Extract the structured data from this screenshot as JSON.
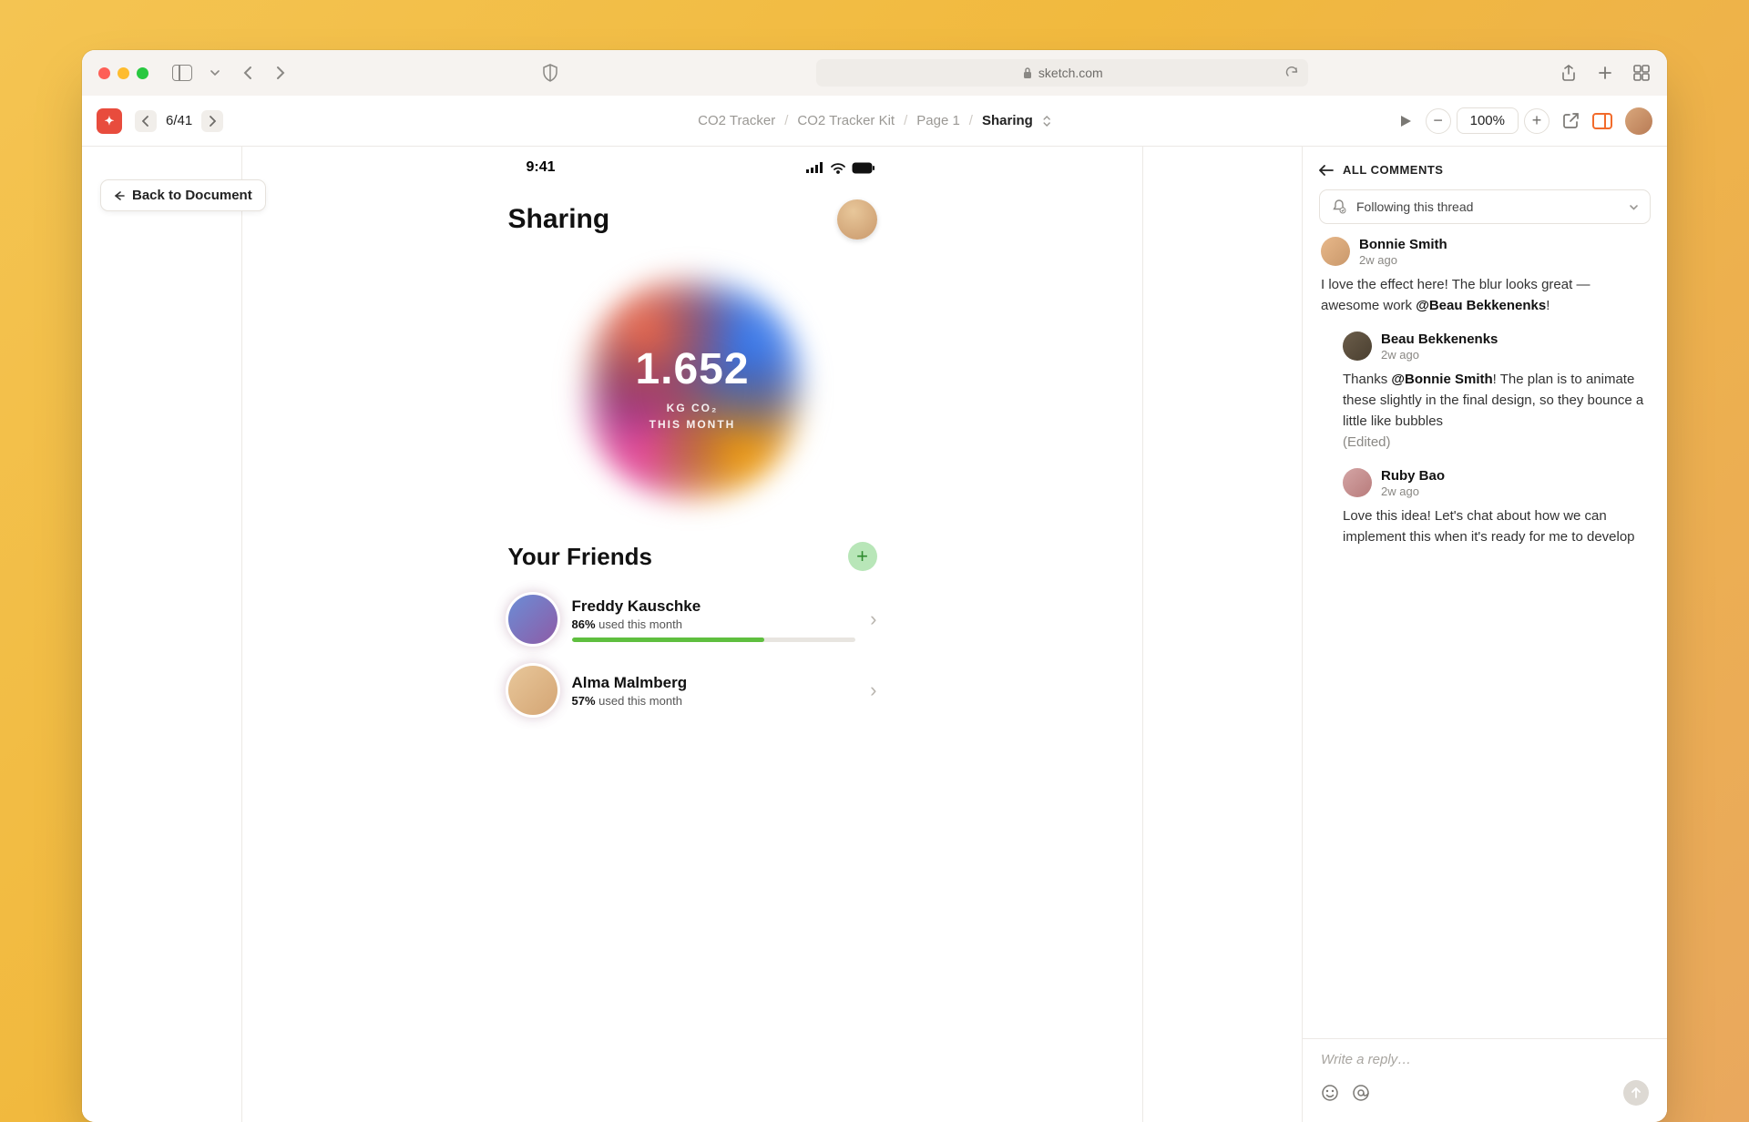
{
  "browser": {
    "url": "sketch.com"
  },
  "toolbar": {
    "page_counter": "6/41",
    "zoom": "100%",
    "breadcrumb": [
      "CO2 Tracker",
      "CO2 Tracker Kit",
      "Page 1",
      "Sharing"
    ]
  },
  "back_chip": "Back to Document",
  "artboard": {
    "status_time": "9:41",
    "title": "Sharing",
    "metric_value": "1.652",
    "metric_label_1": "KG CO₂",
    "metric_label_2": "THIS MONTH",
    "friends_heading": "Your Friends",
    "friends": [
      {
        "name": "Freddy Kauschke",
        "percent": "86%",
        "suffix": " used this month",
        "bar": 68
      },
      {
        "name": "Alma Malmberg",
        "percent": "57%",
        "suffix": " used this month",
        "bar": 0
      }
    ]
  },
  "comments": {
    "header": "ALL COMMENTS",
    "follow_label": "Following this thread",
    "reply_placeholder": "Write a reply…",
    "items": [
      {
        "author": "Bonnie Smith",
        "time": "2w ago",
        "text_pre": "I love the effect here! The blur looks great — awesome work ",
        "mention": "@Beau Bekkenenks",
        "text_post": "!",
        "edited": false
      },
      {
        "author": "Beau Bekkenenks",
        "time": "2w ago",
        "text_pre": "Thanks ",
        "mention": "@Bonnie Smith",
        "text_post": "! The plan is to animate these slightly in the final design, so they bounce a little like bubbles",
        "edited": true,
        "edited_label": "(Edited)"
      },
      {
        "author": "Ruby Bao",
        "time": "2w ago",
        "text_pre": "Love this idea! Let's chat about how we can implement this when it's ready for me to develop",
        "mention": "",
        "text_post": "",
        "edited": false
      }
    ]
  }
}
